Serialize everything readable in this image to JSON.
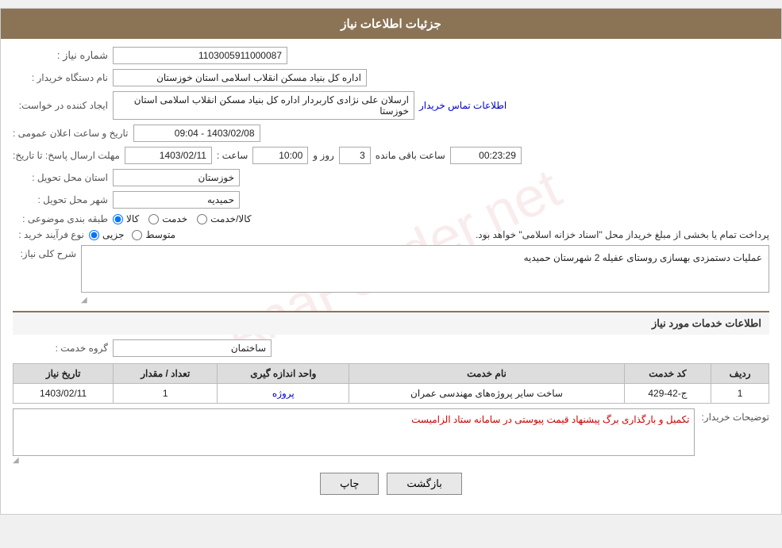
{
  "header": {
    "title": "جزئیات اطلاعات نیاز"
  },
  "fields": {
    "need_number_label": "شماره نیاز :",
    "need_number_value": "1103005911000087",
    "buyer_org_label": "نام دستگاه خریدار :",
    "buyer_org_value": "اداره کل بنیاد مسکن انقلاب اسلامی استان خوزستان",
    "creator_label": "ایجاد کننده در خواست:",
    "creator_value": "ارسلان علی نژادی کاربردار اداره کل بنیاد مسکن انقلاب اسلامی استان خوزستا",
    "contact_link": "اطلاعات تماس خریدار",
    "announce_label": "تاریخ و ساعت اعلان عمومی :",
    "announce_value": "1403/02/08 - 09:04",
    "deadline_label": "مهلت ارسال پاسخ: تا تاریخ:",
    "deadline_date": "1403/02/11",
    "deadline_time_label": "ساعت :",
    "deadline_time": "10:00",
    "deadline_days_label": "روز و",
    "deadline_days": "3",
    "remaining_label": "ساعت باقی مانده",
    "remaining_time": "00:23:29",
    "province_label": "استان محل تحویل :",
    "province_value": "خوزستان",
    "city_label": "شهر محل تحویل :",
    "city_value": "حمیدیه",
    "category_label": "طبقه بندی موضوعی :",
    "category_options": [
      {
        "label": "کالا",
        "value": "kala"
      },
      {
        "label": "خدمت",
        "value": "khedmat"
      },
      {
        "label": "کالا/خدمت",
        "value": "kala_khedmat"
      }
    ],
    "category_selected": "kala",
    "process_label": "نوع فرآیند خرید :",
    "process_options": [
      {
        "label": "جزیی",
        "value": "jozi"
      },
      {
        "label": "متوسط",
        "value": "motavasset"
      }
    ],
    "process_selected": "jozi",
    "process_description": "پرداخت تمام یا بخشی از مبلغ خریداز محل \"اسناد خزانه اسلامی\" خواهد بود.",
    "need_description_label": "شرح کلی نیاز:",
    "need_description": "عملیات دستمزدی بهسازی روستای عفیله 2  شهرستان حمیدیه",
    "service_info_title": "اطلاعات خدمات مورد نیاز",
    "service_group_label": "گروه خدمت :",
    "service_group_value": "ساختمان",
    "table": {
      "headers": [
        "ردیف",
        "کد خدمت",
        "نام خدمت",
        "واحد اندازه گیری",
        "تعداد / مقدار",
        "تاریخ نیاز"
      ],
      "rows": [
        {
          "row": "1",
          "code": "ج-42-429",
          "name": "ساخت سایر پروژه‌های مهندسی عمران",
          "unit": "پروژه",
          "qty": "1",
          "date": "1403/02/11"
        }
      ]
    },
    "buyer_notes_label": "توضیحات خریدار:",
    "buyer_notes": "تکمیل و بارگذاری برگ پیشنهاد قیمت پیوستی در سامانه ستاد الزامیست"
  },
  "buttons": {
    "print": "چاپ",
    "back": "بازگشت"
  }
}
